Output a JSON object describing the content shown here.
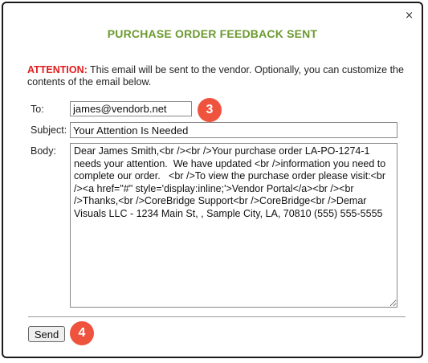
{
  "dialog": {
    "close_glyph": "×",
    "title": "PURCHASE ORDER FEEDBACK SENT"
  },
  "notice": {
    "label": "ATTENTION:",
    "text": " This email will be sent to the vendor. Optionally, you can customize the contents of the email below."
  },
  "form": {
    "to_label": "To:",
    "to_value": "james@vendorb.net",
    "subject_label": "Subject:",
    "subject_value": "Your Attention Is Needed",
    "body_label": "Body:",
    "body_value": "Dear James Smith,<br /><br />Your purchase order LA-PO-1274-1 needs your attention.  We have updated <br />information you need to complete our order.   <br />To view the purchase order please visit:<br /><a href=\"#\" style='display:inline;'>Vendor Portal</a><br /><br />Thanks,<br />CoreBridge Support<br />CoreBridge<br />Demar Visuals LLC - 1234 Main St, , Sample City, LA, 70810 (555) 555-5555"
  },
  "actions": {
    "send_label": "Send"
  },
  "annotations": {
    "step_to": "3",
    "step_send": "4",
    "badge_color": "#f0533d"
  },
  "colors": {
    "title": "#6b9a2e",
    "attention": "#e01b1b"
  }
}
